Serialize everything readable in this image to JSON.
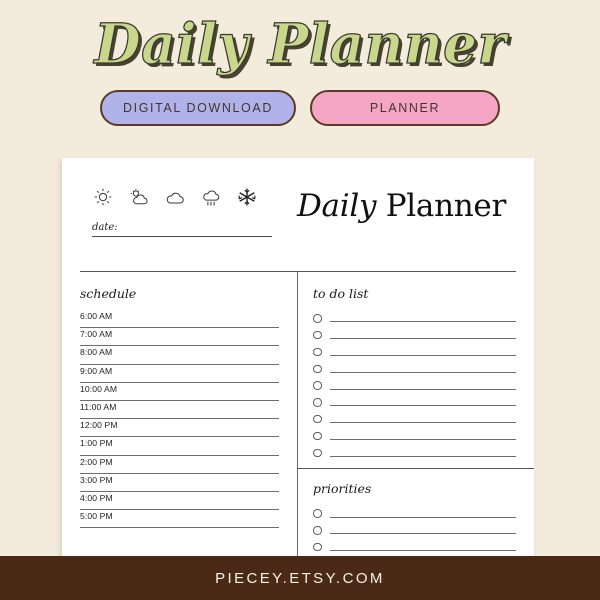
{
  "hero": {
    "title": "Daily Planner",
    "title_color": "#c8d78c",
    "outline_color": "#3a3a2e"
  },
  "tags": [
    {
      "label": "DIGITAL DOWNLOAD",
      "color": "#b0b2ea",
      "name": "tag-digital-download"
    },
    {
      "label": "PLANNER",
      "color": "#f5a6c5",
      "name": "tag-planner"
    }
  ],
  "sheet": {
    "title_italic": "Daily",
    "title_regular": " Planner",
    "date_label": "date:",
    "weather_icons": [
      "sun-icon",
      "sun-behind-cloud-icon",
      "cloud-icon",
      "cloud-rain-icon",
      "snowflake-icon"
    ],
    "schedule": {
      "heading": "schedule",
      "times": [
        "6:00 AM",
        "7:00 AM",
        "8:00 AM",
        "9:00 AM",
        "10:00 AM",
        "11:00 AM",
        "12:00 PM",
        "1:00 PM",
        "2:00 PM",
        "3:00 PM",
        "4:00 PM",
        "5:00 PM"
      ]
    },
    "todo": {
      "heading": "to do list",
      "item_count": 9
    },
    "priorities": {
      "heading": "priorities",
      "item_count": 3
    }
  },
  "footer": {
    "text": "PIECEY.ETSY.COM",
    "background": "#4a2a17"
  },
  "page": {
    "background": "#f3ecdc"
  }
}
